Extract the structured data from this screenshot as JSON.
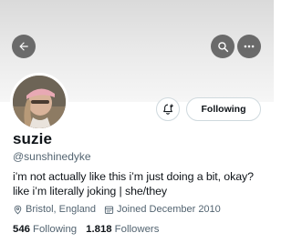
{
  "profile": {
    "display_name": "suzie",
    "handle": "@sunshinedyke",
    "bio": "i’m not actually like this i’m just doing a bit, okay? like i’m literally joking | she/they",
    "location": "Bristol, England",
    "joined": "Joined December 2010"
  },
  "actions": {
    "following_label": "Following"
  },
  "stats": {
    "following_count": "546",
    "following_label": "Following",
    "followers_count": "1.818",
    "followers_label": "Followers"
  },
  "icons": {
    "back": "arrow-left-icon",
    "search": "search-icon",
    "more": "more-horizontal-icon",
    "notify": "bell-plus-icon",
    "location": "location-pin-icon",
    "calendar": "calendar-icon"
  },
  "colors": {
    "banner": "#e3e3e3",
    "text_primary": "#0f1419",
    "text_secondary": "#536471",
    "border": "#cfd9de",
    "header_button": "#464646"
  }
}
